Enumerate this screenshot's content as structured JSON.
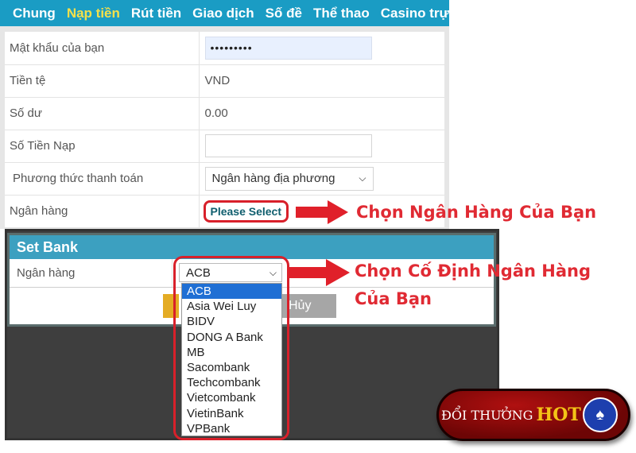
{
  "nav": {
    "items": [
      {
        "label": "Chung",
        "active": false
      },
      {
        "label": "Nạp tiền",
        "active": true
      },
      {
        "label": "Rút tiền",
        "active": false
      },
      {
        "label": "Giao dịch",
        "active": false
      },
      {
        "label": "Số đề",
        "active": false
      },
      {
        "label": "Thể thao",
        "active": false
      },
      {
        "label": "Casino trực tuyến",
        "active": false
      }
    ]
  },
  "form": {
    "password": {
      "label": "Mật khẩu của bạn",
      "value": "•••••••••"
    },
    "currency": {
      "label": "Tiền tệ",
      "value": "VND"
    },
    "balance": {
      "label": "Số dư",
      "value": "0.00"
    },
    "deposit_amount": {
      "label": "Số Tiền Nạp",
      "value": ""
    },
    "payment_method": {
      "label": "Phương thức thanh toán",
      "value": "Ngân hàng địa phương"
    },
    "bank": {
      "label": "Ngân hàng",
      "value": "Please Select"
    }
  },
  "annotations": {
    "choose_bank": "Chọn Ngân Hàng Của Bạn",
    "fixed_bank_line1": "Chọn Cố Định  Ngân Hàng",
    "fixed_bank_line2": "Của Bạn"
  },
  "modal": {
    "title": "Set Bank",
    "bank_label": "Ngân hàng",
    "selected_bank": "ACB",
    "cancel_label": "Hủy",
    "options": [
      "ACB",
      "Asia Wei Luy",
      "BIDV",
      "DONG A Bank",
      "MB",
      "Sacombank",
      "Techcombank",
      "Vietcombank",
      "VietinBank",
      "VPBank"
    ]
  },
  "logo": {
    "text": "ĐỔI THƯỞNG",
    "hot": "HOT",
    "badge_icon": "playing-cards"
  },
  "colors": {
    "nav_bg": "#1a9cc4",
    "nav_active": "#f4e04a",
    "annotation_red": "#e02a33",
    "modal_header": "#3ca0c0",
    "selected_option": "#1f6fd4"
  }
}
